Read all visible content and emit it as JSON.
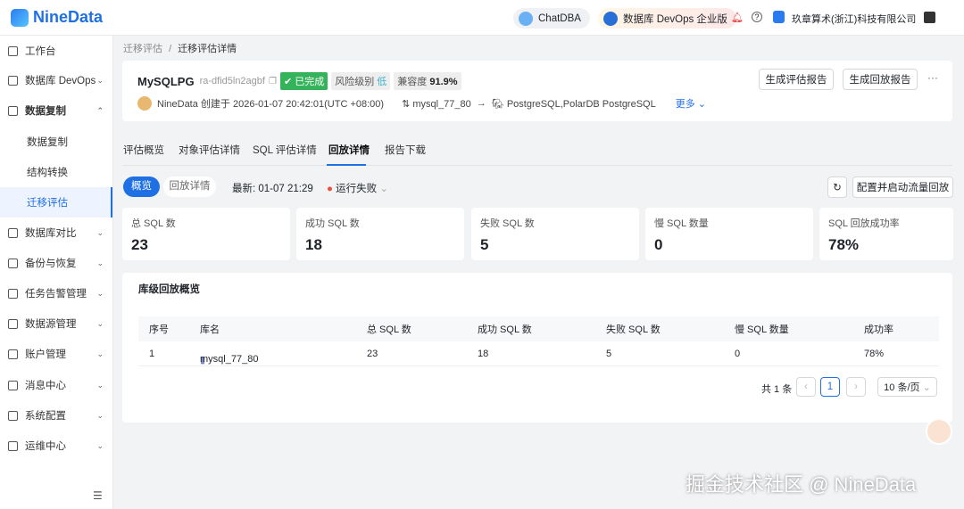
{
  "header": {
    "logo": "NineData",
    "chatdba": "ChatDBA",
    "devops": "数据库 DevOps 企业版",
    "company": "玖章算术(浙江)科技有限公司"
  },
  "sidebar": {
    "items": [
      {
        "label": "工作台"
      },
      {
        "label": "数据库 DevOps"
      },
      {
        "label": "数据复制"
      },
      {
        "label": "数据复制"
      },
      {
        "label": "结构转换"
      },
      {
        "label": "迁移评估"
      },
      {
        "label": "数据库对比"
      },
      {
        "label": "备份与恢复"
      },
      {
        "label": "任务告警管理"
      },
      {
        "label": "数据源管理"
      },
      {
        "label": "账户管理"
      },
      {
        "label": "消息中心"
      },
      {
        "label": "系统配置"
      },
      {
        "label": "运维中心"
      }
    ]
  },
  "breadcrumb": [
    "迁移评估",
    "/",
    "迁移评估详情"
  ],
  "task": {
    "name": "MySQLPG",
    "id": "ra-dfid5ln2agbf",
    "status": "已完成",
    "risk_label": "风险级别",
    "risk": "低",
    "compat_label": "兼容度",
    "compat": "91.9%",
    "creator": "NineData 创建于 2026-01-07 20:42:01(UTC +08:00)",
    "source": "mysql_77_80",
    "arrow": "→",
    "target": "PostgreSQL,PolarDB PostgreSQL",
    "more": "更多",
    "btn_report": "生成评估报告",
    "btn_replay_report": "生成回放报告",
    "ellipsis": "···"
  },
  "tabs": [
    "评估概览",
    "对象评估详情",
    "SQL 评估详情",
    "回放详情",
    "报告下载"
  ],
  "toolbar": {
    "overview": "概览",
    "detail": "回放详情",
    "latest": "最新: 01-07 21:29",
    "status": "运行失败",
    "config": "配置并启动流量回放"
  },
  "stats": [
    {
      "label": "总 SQL 数",
      "value": "23"
    },
    {
      "label": "成功 SQL 数",
      "value": "18"
    },
    {
      "label": "失败 SQL 数",
      "value": "5"
    },
    {
      "label": "慢 SQL 数量",
      "value": "0"
    },
    {
      "label": "SQL 回放成功率",
      "value": "78%"
    }
  ],
  "table": {
    "title": "库级回放概览",
    "headers": [
      "序号",
      "库名",
      "总 SQL 数",
      "成功 SQL 数",
      "失败 SQL 数",
      "慢 SQL 数量",
      "成功率"
    ],
    "rows": [
      [
        "1",
        "mysql_77_80",
        "23",
        "18",
        "5",
        "0",
        "78%"
      ]
    ],
    "total": "共 1 条",
    "page": "1",
    "page_size": "10 条/页",
    "prev": "‹",
    "next": "›"
  },
  "watermark": "掘金技术社区 @ NineData"
}
